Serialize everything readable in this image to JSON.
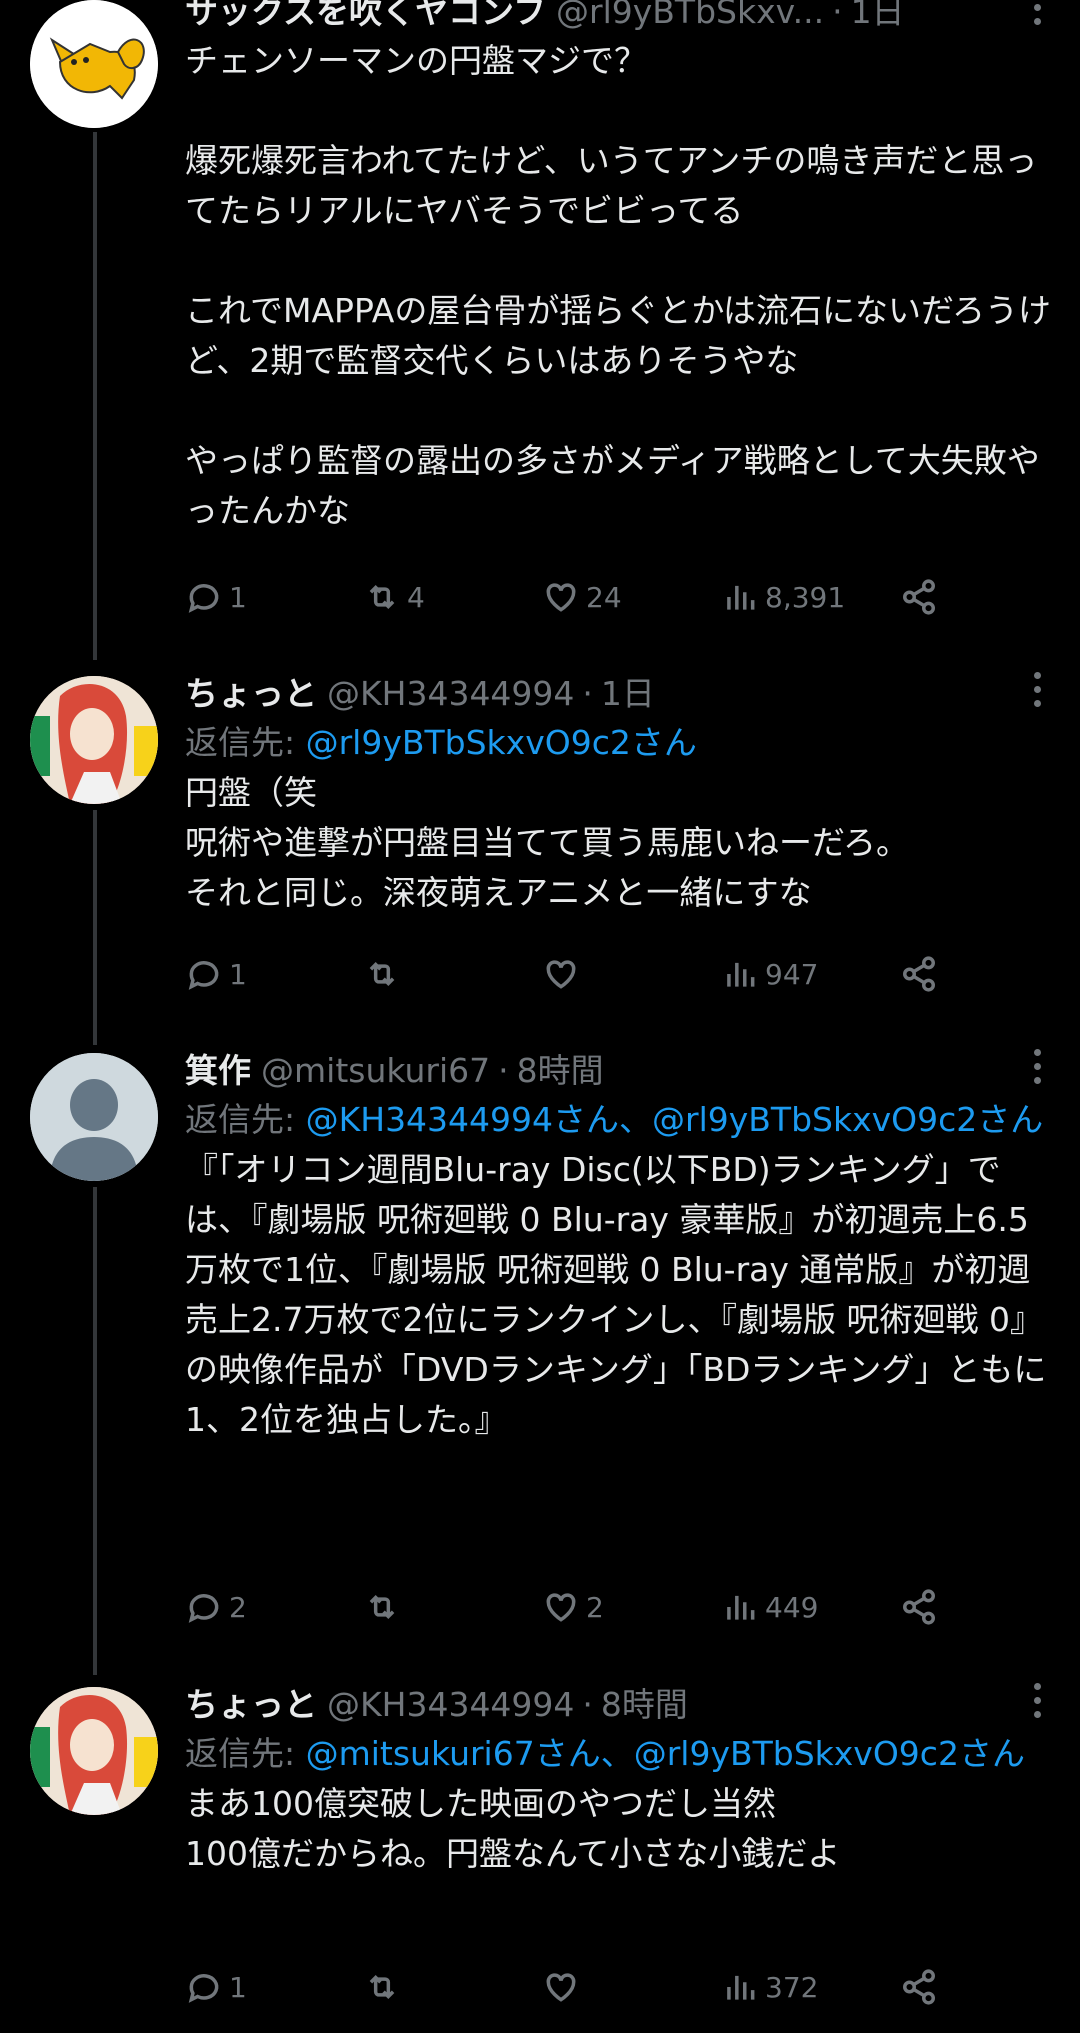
{
  "tweets": [
    {
      "name": "サックスを吹くヤコンフ",
      "handle": "@rl9yBTbSkxv...",
      "dot": "·",
      "time": "1日",
      "reply_prefix": "",
      "reply_mentions": "",
      "body": "チェンソーマンの円盤マジで？\n\n爆死爆死言われてたけど、いうてアンチの鳴き声だと思ってたらリアルにヤバそうでビビってる\n\nこれでMAPPAの屋台骨が揺らぐとかは流石にないだろうけど、2期で監督交代くらいはありそうやな\n\nやっぱり監督の露出の多さがメディア戦略として大失敗やったんかな",
      "replies": "1",
      "retweets": "4",
      "likes": "24",
      "views": "8,391"
    },
    {
      "name": "ちょっと",
      "handle": "@KH34344994",
      "dot": "·",
      "time": "1日",
      "reply_prefix": "返信先: ",
      "reply_mentions": "@rl9yBTbSkxvO9c2さん",
      "body": "円盤（笑\n呪術や進撃が円盤目当てて買う馬鹿いねーだろ。\nそれと同じ。深夜萌えアニメと一緒にすな",
      "replies": "1",
      "retweets": "",
      "likes": "",
      "views": "947"
    },
    {
      "name": "箕作",
      "handle": "@mitsukuri67",
      "dot": "·",
      "time": "8時間",
      "reply_prefix": "返信先: ",
      "reply_mentions": "@KH34344994さん、@rl9yBTbSkxvO9c2さん",
      "body": "『「オリコン週間Blu-ray Disc(以下BD)ランキング」では、『劇場版 呪術廻戦 0 Blu-ray 豪華版』が初週売上6.5万枚で1位、『劇場版 呪術廻戦 0 Blu-ray 通常版』が初週売上2.7万枚で2位にランクインし、『劇場版 呪術廻戦 0』の映像作品が「DVDランキング」「BDランキング」ともに1、2位を独占した。』",
      "replies": "2",
      "retweets": "",
      "likes": "2",
      "views": "449"
    },
    {
      "name": "ちょっと",
      "handle": "@KH34344994",
      "dot": "·",
      "time": "8時間",
      "reply_prefix": "返信先: ",
      "reply_mentions": "@mitsukuri67さん、@rl9yBTbSkxvO9c2さん",
      "body": "まあ100億突破した映画のやつだし当然\n100億だからね。円盤なんて小さな小銭だよ",
      "replies": "1",
      "retweets": "",
      "likes": "",
      "views": "372"
    }
  ],
  "colors": {
    "text": "#e7e9ea",
    "muted": "#71767b",
    "link": "#1d9bf0",
    "background": "#000000"
  },
  "icons": [
    "reply-icon",
    "retweet-icon",
    "like-icon",
    "views-icon",
    "share-icon",
    "more-icon"
  ]
}
